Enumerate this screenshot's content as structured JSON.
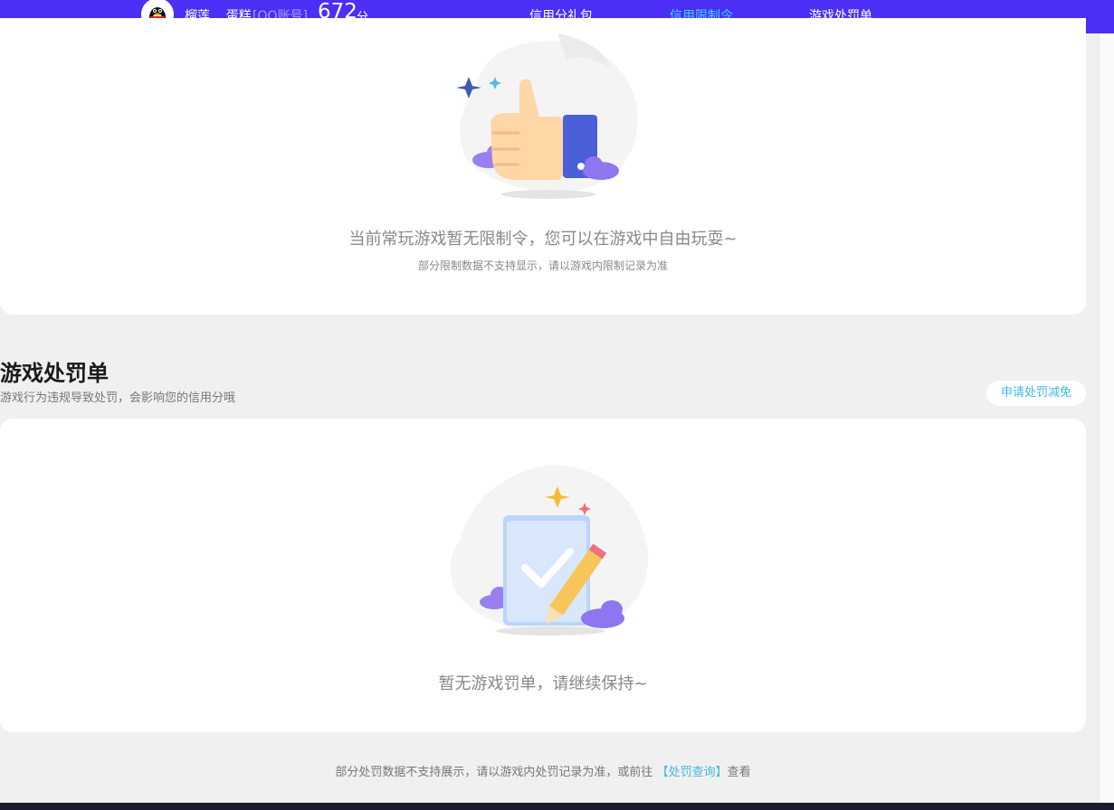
{
  "header": {
    "username": "榴莲....蛋糕",
    "account_type": "[QQ账号]",
    "score": "672",
    "score_unit": "分",
    "tabs": [
      {
        "label": "信用分礼包",
        "active": false
      },
      {
        "label": "信用限制令",
        "active": true
      },
      {
        "label": "游戏处罚单",
        "active": false
      }
    ]
  },
  "restriction_card": {
    "message": "当前常玩游戏暂无限制令，您可以在游戏中自由玩耍~",
    "note": "部分限制数据不支持显示，请以游戏内限制记录为准"
  },
  "penalty_section": {
    "title": "游戏处罚单",
    "subtitle": "游戏行为违规导致处罚，会影响您的信用分哦",
    "apply_button": "申请处罚减免",
    "message": "暂无游戏罚单，请继续保持~"
  },
  "footer": {
    "note_prefix": "部分处罚数据不支持展示，请以游戏内处罚记录为准，或前往",
    "link": "【处罚查询】",
    "note_suffix": "查看"
  },
  "colors": {
    "topbar": "#4b2ff5",
    "active_tab": "#3fd6ff",
    "link": "#3fb8e0"
  }
}
